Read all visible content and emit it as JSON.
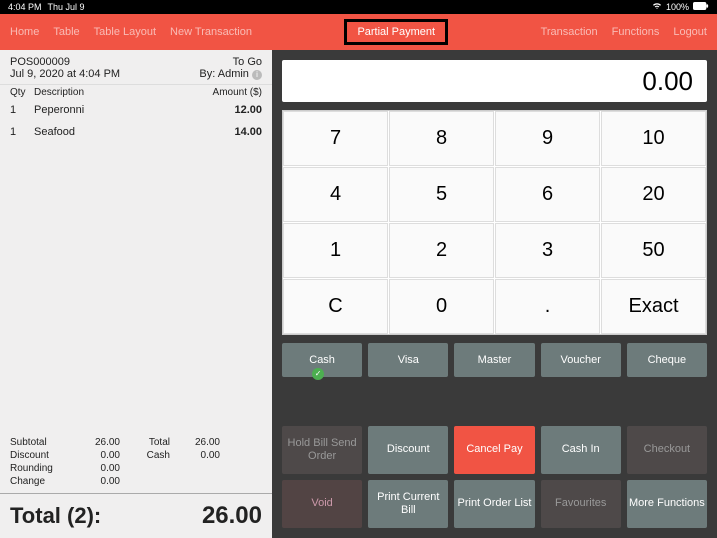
{
  "status": {
    "time": "4:04 PM",
    "date": "Thu Jul 9",
    "battery": "100%"
  },
  "nav": {
    "home": "Home",
    "table": "Table",
    "tableLayout": "Table Layout",
    "newTx": "New Transaction",
    "partial": "Partial Payment",
    "transaction": "Transaction",
    "functions": "Functions",
    "logout": "Logout"
  },
  "receipt": {
    "posId": "POS000009",
    "mode": "To Go",
    "datetime": "Jul 9, 2020 at 4:04 PM",
    "by": "By: Admin",
    "colQty": "Qty",
    "colDesc": "Description",
    "colAmt": "Amount ($)",
    "items": [
      {
        "qty": "1",
        "desc": "Peperonni",
        "amt": "12.00"
      },
      {
        "qty": "1",
        "desc": "Seafood",
        "amt": "14.00"
      }
    ],
    "summary": {
      "subtotalLbl": "Subtotal",
      "subtotal": "26.00",
      "totalLbl": "Total",
      "total": "26.00",
      "discountLbl": "Discount",
      "discount": "0.00",
      "cashLbl": "Cash",
      "cash": "0.00",
      "roundingLbl": "Rounding",
      "rounding": "0.00",
      "changeLbl": "Change",
      "change": "0.00"
    },
    "totalLabel": "Total (2):",
    "totalValue": "26.00"
  },
  "display": "0.00",
  "keys": {
    "k7": "7",
    "k8": "8",
    "k9": "9",
    "k10": "10",
    "k4": "4",
    "k5": "5",
    "k6": "6",
    "k20": "20",
    "k1": "1",
    "k2": "2",
    "k3": "3",
    "k50": "50",
    "kc": "C",
    "k0": "0",
    "kd": ".",
    "kex": "Exact"
  },
  "pay": {
    "cash": "Cash",
    "visa": "Visa",
    "master": "Master",
    "voucher": "Voucher",
    "cheque": "Cheque"
  },
  "fn": {
    "hold": "Hold Bill Send Order",
    "discount": "Discount",
    "cancel": "Cancel Pay",
    "cashin": "Cash In",
    "checkout": "Checkout",
    "void": "Void",
    "printBill": "Print Current Bill",
    "printOrder": "Print Order List",
    "fav": "Favourites",
    "more": "More Functions"
  }
}
